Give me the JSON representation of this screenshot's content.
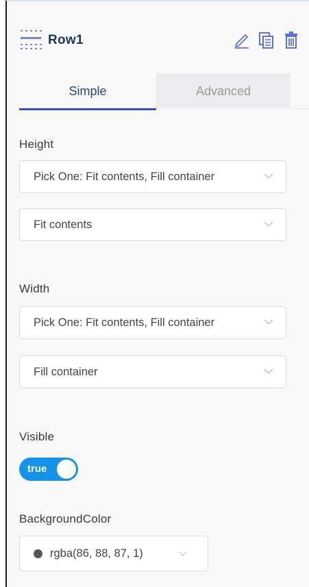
{
  "header": {
    "title": "Row1",
    "icons": [
      "grid-dots-icon",
      "pencil-icon",
      "copy-icon",
      "trash-icon"
    ]
  },
  "tabs": [
    {
      "label": "Simple",
      "active": true
    },
    {
      "label": "Advanced",
      "active": false
    }
  ],
  "height": {
    "label": "Height",
    "mode_select": "Pick One: Fit contents, Fill container",
    "value_select": "Fit contents"
  },
  "width": {
    "label": "Width",
    "mode_select": "Pick One: Fit contents, Fill container",
    "value_select": "Fill container"
  },
  "visible": {
    "label": "Visible",
    "toggle_label": "true",
    "on": true
  },
  "background": {
    "label": "BackgroundColor",
    "value": "rgba(86, 88, 87, 1)",
    "swatch": "#565857"
  },
  "colors": {
    "accent_blue": "#1593e8",
    "tab_underline": "#3a49c9",
    "title": "#1f3658",
    "icon_blue": "#4a6de0"
  }
}
